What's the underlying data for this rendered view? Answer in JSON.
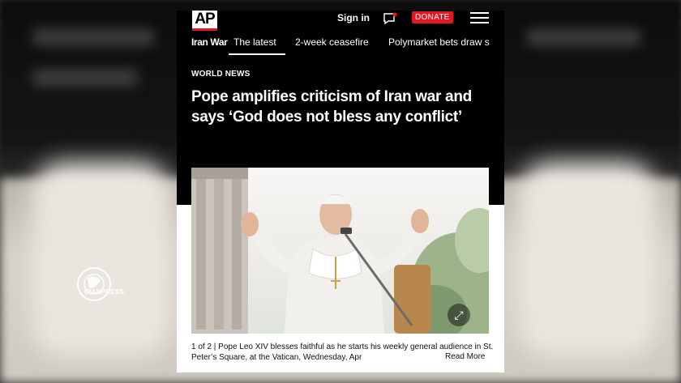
{
  "header": {
    "logo_text": "AP",
    "signin_label": "Sign in",
    "donate_label": "DONATE"
  },
  "nav": {
    "section": "Iran War",
    "items": [
      "The latest",
      "2-week ceasefire",
      "Polymarket bets draw s"
    ]
  },
  "article": {
    "category": "WORLD NEWS",
    "headline": "Pope amplifies criticism of Iran war and says ‘God does not bless any conflict’",
    "caption": "1 of 2 |  Pope Leo XIV blesses faithful as he starts his weekly general audience in St. Peter’s Square, at the Vatican, Wednesday, Apr",
    "read_more": "Read More"
  },
  "watermark": {
    "text": "IRANPRESS"
  },
  "colors": {
    "brand_red": "#e4161f",
    "dark_bg": "#000000",
    "light_bg": "#ffffff"
  },
  "icons": [
    "chat-icon",
    "hamburger-menu-icon",
    "expand-icon",
    "iranpress-logo"
  ]
}
